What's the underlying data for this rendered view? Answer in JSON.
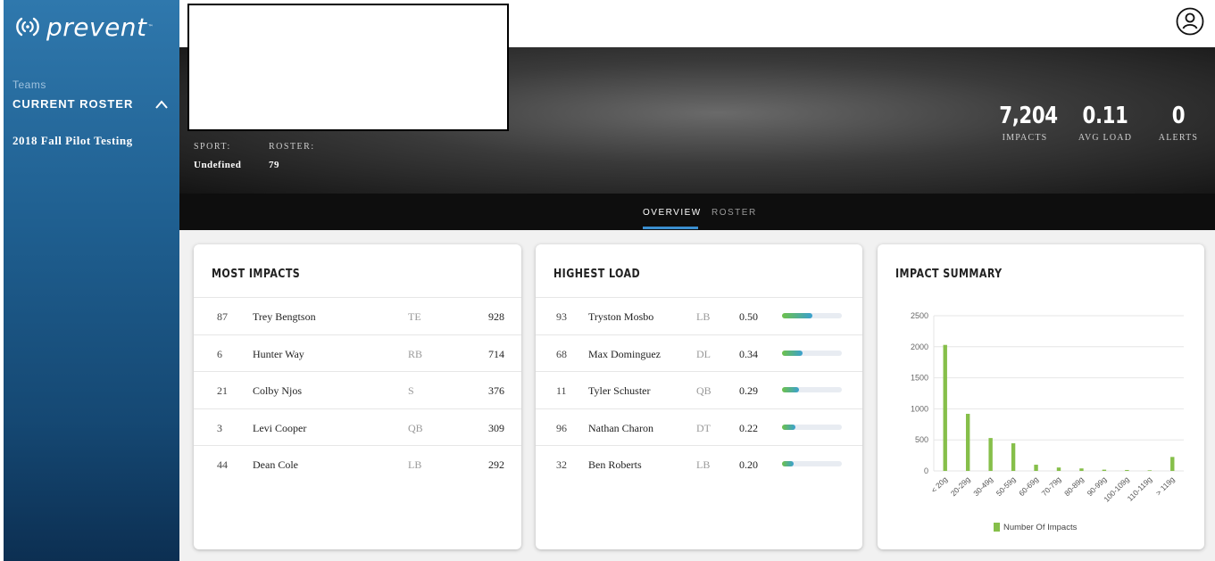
{
  "app": {
    "logo_text": "prevent",
    "logo_tm": "™"
  },
  "sidebar": {
    "teams_label": "Teams",
    "current_roster_label": "CURRENT ROSTER",
    "team_item": "2018 Fall Pilot Testing"
  },
  "hero": {
    "sport_label": "SPORT:",
    "sport_value": "Undefined",
    "roster_label": "ROSTER:",
    "roster_value": "79",
    "stats": {
      "impacts": "7,204",
      "impacts_label": "IMPACTS",
      "avg_load": "0.11",
      "avg_load_label": "AVG LOAD",
      "alerts": "0",
      "alerts_label": "ALERTS"
    }
  },
  "tabs": [
    {
      "label": "OVERVIEW",
      "active": true
    },
    {
      "label": "ROSTER",
      "active": false
    }
  ],
  "most_impacts": {
    "title": "MOST IMPACTS",
    "rows": [
      {
        "number": "87",
        "name": "Trey Bengtson",
        "position": "TE",
        "value": "928"
      },
      {
        "number": "6",
        "name": "Hunter Way",
        "position": "RB",
        "value": "714"
      },
      {
        "number": "21",
        "name": "Colby Njos",
        "position": "S",
        "value": "376"
      },
      {
        "number": "3",
        "name": "Levi Cooper",
        "position": "QB",
        "value": "309"
      },
      {
        "number": "44",
        "name": "Dean Cole",
        "position": "LB",
        "value": "292"
      }
    ]
  },
  "highest_load": {
    "title": "HIGHEST LOAD",
    "rows": [
      {
        "number": "93",
        "name": "Tryston Mosbo",
        "position": "LB",
        "value": "0.50",
        "level": 0.5
      },
      {
        "number": "68",
        "name": "Max Dominguez",
        "position": "DL",
        "value": "0.34",
        "level": 0.34
      },
      {
        "number": "11",
        "name": "Tyler Schuster",
        "position": "QB",
        "value": "0.29",
        "level": 0.29
      },
      {
        "number": "96",
        "name": "Nathan Charon",
        "position": "DT",
        "value": "0.22",
        "level": 0.22
      },
      {
        "number": "32",
        "name": "Ben Roberts",
        "position": "LB",
        "value": "0.20",
        "level": 0.2
      }
    ]
  },
  "impact_summary": {
    "title": "IMPACT SUMMARY"
  },
  "chart_data": {
    "type": "bar",
    "categories": [
      "< 20g",
      "20-29g",
      "30-49g",
      "50-59g",
      "60-69g",
      "70-79g",
      "80-89g",
      "90-99g",
      "100-109g",
      "110-119g",
      "> 119g"
    ],
    "series": [
      {
        "name": "Number Of Impacts",
        "values": [
          2030,
          920,
          530,
          445,
          100,
          55,
          40,
          20,
          15,
          10,
          225
        ]
      }
    ],
    "ylim": [
      0,
      2500
    ],
    "yticks": [
      0,
      500,
      1000,
      1500,
      2000,
      2500
    ],
    "grid": true,
    "legend": "bottom",
    "color": "#86bf4a"
  }
}
